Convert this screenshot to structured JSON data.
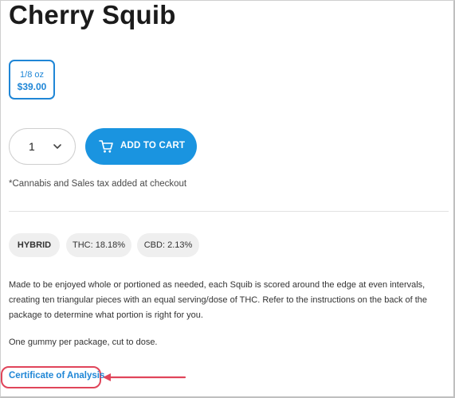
{
  "product": {
    "title": "Cherry Squib",
    "variant": {
      "size": "1/8 oz",
      "price": "$39.00"
    },
    "quantity": "1",
    "add_to_cart_label": "ADD TO CART",
    "tax_note": "*Cannabis and Sales tax added at checkout",
    "tags": {
      "type": "HYBRID",
      "thc": "THC: 18.18%",
      "cbd": "CBD: 2.13%"
    },
    "description": "Made to be enjoyed whole or portioned as needed, each Squib is scored around the edge at even intervals, creating ten triangular pieces with an equal serving/dose of THC. Refer to the instructions on the back of the package to determine what portion is right for you.",
    "usage_note": "One gummy per package, cut to dose.",
    "certificate_link": "Certificate of Analysis"
  },
  "colors": {
    "accent": "#1a94e0",
    "link": "#1f86d6",
    "highlight": "#e0455a",
    "chip_bg": "#efefef"
  },
  "icons": {
    "cart": "cart-icon",
    "chevron": "chevron-down-icon",
    "arrow": "arrow-left-icon"
  }
}
